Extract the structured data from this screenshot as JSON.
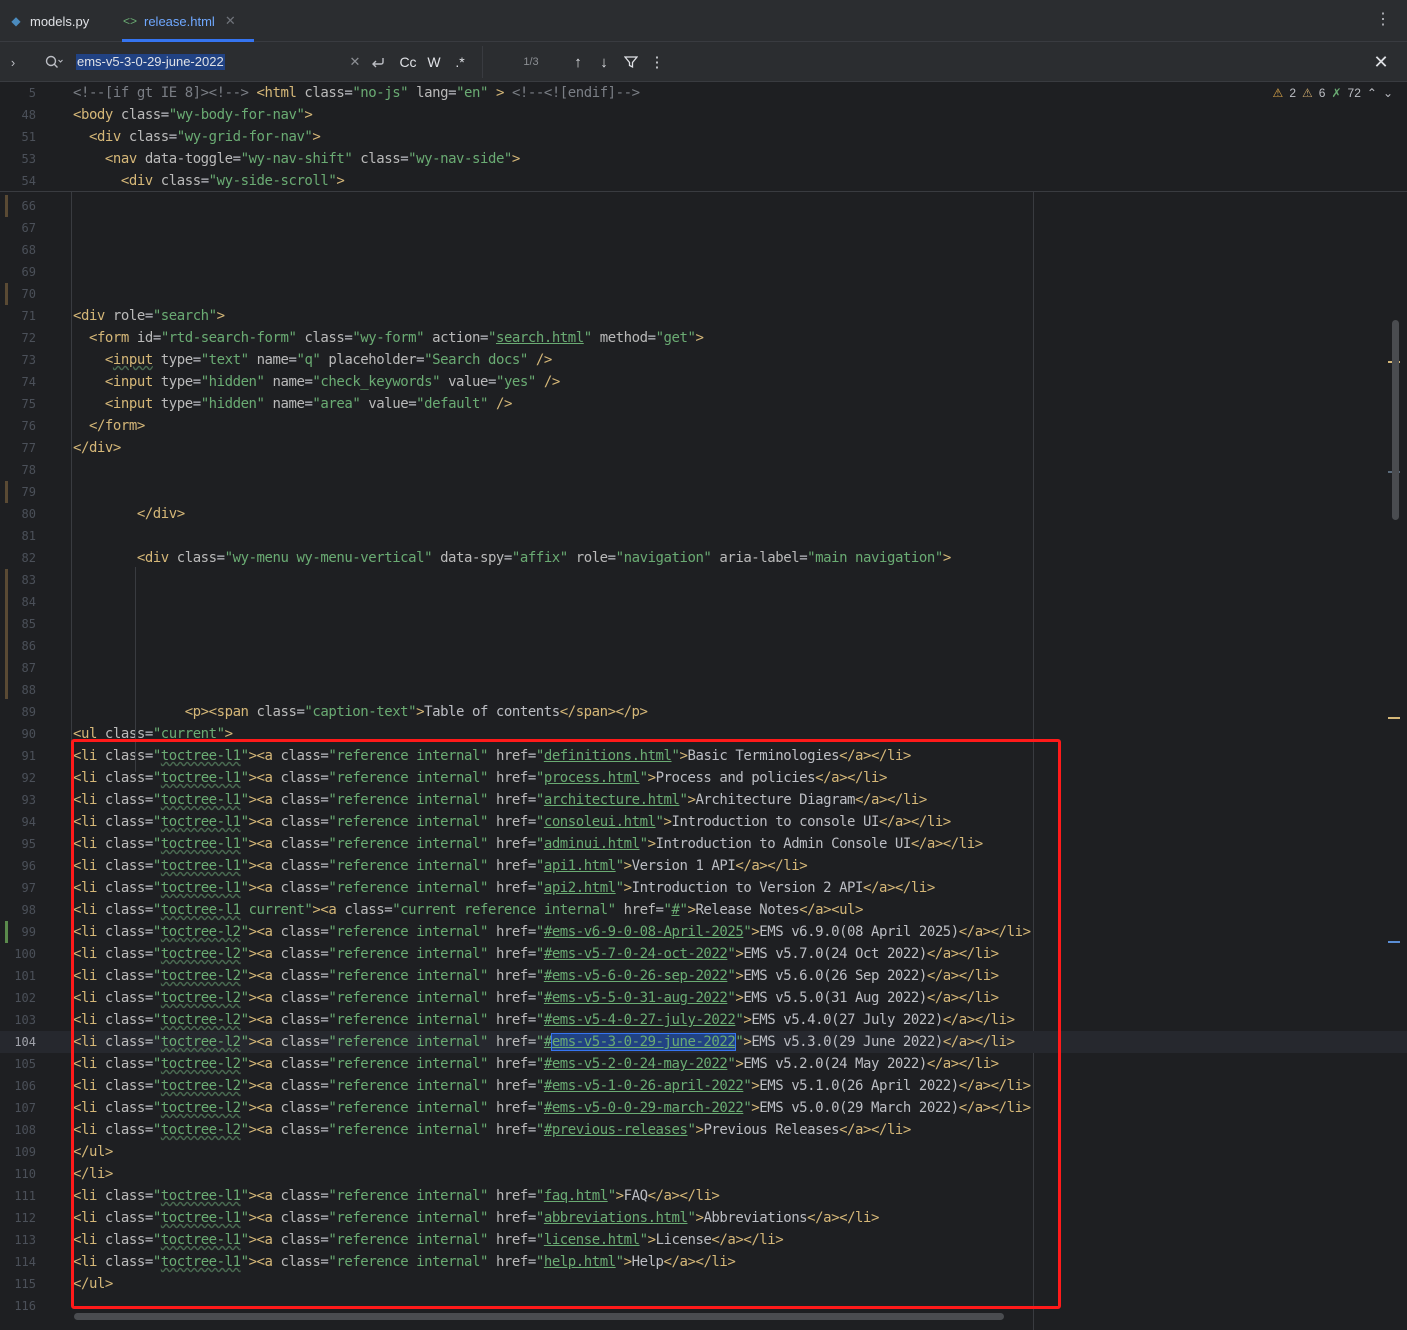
{
  "tabs": [
    {
      "label": "models.py",
      "icon": "python-icon"
    },
    {
      "label": "release.html",
      "icon": "html-icon",
      "active": true
    }
  ],
  "search": {
    "query": "ems-v5-3-0-29-june-2022",
    "count": "1/3",
    "case_label": "Cc",
    "word_label": "W",
    "regex_label": ".*"
  },
  "inspections": {
    "warnings_a": "2",
    "warnings_b": "6",
    "typos": "72"
  },
  "sticky_lines": [
    {
      "num": "5",
      "html": "<span class='c'>&lt;!--[if gt IE 8]&gt;&lt;!--&gt;</span> <span class='t'>&lt;html</span> <span class='a'>class</span>=<span class='v'>\"no-js\"</span> <span class='a'>lang</span>=<span class='v'>\"en\"</span> <span class='t'>&gt;</span> <span class='c'>&lt;!--&lt;![endif]--&gt;</span>"
    },
    {
      "num": "48",
      "html": "<span class='t'>&lt;body</span> <span class='a'>class</span>=<span class='v'>\"wy-body-for-nav\"</span><span class='t'>&gt;</span>"
    },
    {
      "num": "51",
      "html": "  <span class='t'>&lt;div</span> <span class='a'>class</span>=<span class='v'>\"wy-grid-for-nav\"</span><span class='t'>&gt;</span>"
    },
    {
      "num": "53",
      "html": "    <span class='t'>&lt;nav</span> <span class='a'>data-toggle</span>=<span class='v'>\"wy-nav-shift\"</span> <span class='a'>class</span>=<span class='v'>\"wy-nav-side\"</span><span class='t'>&gt;</span>"
    },
    {
      "num": "54",
      "html": "      <span class='t'>&lt;div</span> <span class='a'>class</span>=<span class='v'>\"wy-side-scroll\"</span><span class='t'>&gt;</span>"
    }
  ],
  "lines": [
    {
      "num": "66",
      "html": ""
    },
    {
      "num": "67",
      "html": ""
    },
    {
      "num": "68",
      "html": ""
    },
    {
      "num": "69",
      "html": ""
    },
    {
      "num": "70",
      "html": ""
    },
    {
      "num": "71",
      "html": "<span class='t'>&lt;div</span> <span class='a'>role</span>=<span class='v'>\"search\"</span><span class='t'>&gt;</span>"
    },
    {
      "num": "72",
      "html": "  <span class='t'>&lt;form</span> <span class='a'>id</span>=<span class='v'>\"rtd-search-form\"</span> <span class='a'>class</span>=<span class='v'>\"wy-form\"</span> <span class='a'>action</span>=<span class='v'>\"</span><span class='u'>search.html</span><span class='v'>\"</span> <span class='a'>method</span>=<span class='v'>\"get\"</span><span class='t'>&gt;</span>"
    },
    {
      "num": "73",
      "html": "    <span class='t'>&lt;<span class='sq'>input</span></span> <span class='a'>type</span>=<span class='v'>\"text\"</span> <span class='a'>name</span>=<span class='v'>\"q\"</span> <span class='a'>placeholder</span>=<span class='v'>\"Search docs\"</span> <span class='t'>/&gt;</span>"
    },
    {
      "num": "74",
      "html": "    <span class='t'>&lt;input</span> <span class='a'>type</span>=<span class='v'>\"hidden\"</span> <span class='a'>name</span>=<span class='v'>\"check_keywords\"</span> <span class='a'>value</span>=<span class='v'>\"yes\"</span> <span class='t'>/&gt;</span>"
    },
    {
      "num": "75",
      "html": "    <span class='t'>&lt;input</span> <span class='a'>type</span>=<span class='v'>\"hidden\"</span> <span class='a'>name</span>=<span class='v'>\"area\"</span> <span class='a'>value</span>=<span class='v'>\"default\"</span> <span class='t'>/&gt;</span>"
    },
    {
      "num": "76",
      "html": "  <span class='t'>&lt;/form&gt;</span>"
    },
    {
      "num": "77",
      "html": "<span class='t'>&lt;/div&gt;</span>"
    },
    {
      "num": "78",
      "html": ""
    },
    {
      "num": "79",
      "html": ""
    },
    {
      "num": "80",
      "html": "        <span class='t'>&lt;/div&gt;</span>"
    },
    {
      "num": "81",
      "html": ""
    },
    {
      "num": "82",
      "html": "        <span class='t'>&lt;div</span> <span class='a'>class</span>=<span class='v'>\"wy-menu wy-menu-vertical\"</span> <span class='a'>data-spy</span>=<span class='v'>\"affix\"</span> <span class='a'>role</span>=<span class='v'>\"navigation\"</span> <span class='a'>aria-label</span>=<span class='v'>\"main navigation\"</span><span class='t'>&gt;</span>"
    },
    {
      "num": "83",
      "html": ""
    },
    {
      "num": "84",
      "html": ""
    },
    {
      "num": "85",
      "html": ""
    },
    {
      "num": "86",
      "html": ""
    },
    {
      "num": "87",
      "html": ""
    },
    {
      "num": "88",
      "html": ""
    },
    {
      "num": "89",
      "html": "              <span class='t'>&lt;p&gt;&lt;span</span> <span class='a'>class</span>=<span class='v'>\"caption-text\"</span><span class='t'>&gt;</span>Table of contents<span class='t'>&lt;/span&gt;&lt;/p&gt;</span>"
    },
    {
      "num": "90",
      "html": "<span class='t'>&lt;ul</span> <span class='a'>class</span>=<span class='v'>\"current\"</span><span class='t'>&gt;</span>"
    },
    {
      "num": "91",
      "html": "<span class='t'>&lt;li</span> <span class='a'>class</span>=<span class='v'>\"<span class='sq'>toctree-l1</span>\"</span><span class='t'>&gt;&lt;a</span> <span class='a'>class</span>=<span class='v'>\"reference internal\"</span> <span class='a'>href</span>=<span class='v'>\"</span><span class='u'>definitions.html</span><span class='v'>\"</span><span class='t'>&gt;</span>Basic Terminologies<span class='t'>&lt;/a&gt;&lt;/li&gt;</span>"
    },
    {
      "num": "92",
      "html": "<span class='t'>&lt;li</span> <span class='a'>class</span>=<span class='v'>\"<span class='sq'>toctree-l1</span>\"</span><span class='t'>&gt;&lt;a</span> <span class='a'>class</span>=<span class='v'>\"reference internal\"</span> <span class='a'>href</span>=<span class='v'>\"</span><span class='u'>process.html</span><span class='v'>\"</span><span class='t'>&gt;</span>Process and policies<span class='t'>&lt;/a&gt;&lt;/li&gt;</span>"
    },
    {
      "num": "93",
      "html": "<span class='t'>&lt;li</span> <span class='a'>class</span>=<span class='v'>\"<span class='sq'>toctree-l1</span>\"</span><span class='t'>&gt;&lt;a</span> <span class='a'>class</span>=<span class='v'>\"reference internal\"</span> <span class='a'>href</span>=<span class='v'>\"</span><span class='u'>architecture.html</span><span class='v'>\"</span><span class='t'>&gt;</span>Architecture Diagram<span class='t'>&lt;/a&gt;&lt;/li&gt;</span>"
    },
    {
      "num": "94",
      "html": "<span class='t'>&lt;li</span> <span class='a'>class</span>=<span class='v'>\"<span class='sq'>toctree-l1</span>\"</span><span class='t'>&gt;&lt;a</span> <span class='a'>class</span>=<span class='v'>\"reference internal\"</span> <span class='a'>href</span>=<span class='v'>\"</span><span class='u'>consoleui.html</span><span class='v'>\"</span><span class='t'>&gt;</span>Introduction to console UI<span class='t'>&lt;/a&gt;&lt;/li&gt;</span>"
    },
    {
      "num": "95",
      "html": "<span class='t'>&lt;li</span> <span class='a'>class</span>=<span class='v'>\"<span class='sq'>toctree-l1</span>\"</span><span class='t'>&gt;&lt;a</span> <span class='a'>class</span>=<span class='v'>\"reference internal\"</span> <span class='a'>href</span>=<span class='v'>\"</span><span class='u'>adminui.html</span><span class='v'>\"</span><span class='t'>&gt;</span>Introduction to Admin Console UI<span class='t'>&lt;/a&gt;&lt;/li&gt;</span>"
    },
    {
      "num": "96",
      "html": "<span class='t'>&lt;li</span> <span class='a'>class</span>=<span class='v'>\"<span class='sq'>toctree-l1</span>\"</span><span class='t'>&gt;&lt;a</span> <span class='a'>class</span>=<span class='v'>\"reference internal\"</span> <span class='a'>href</span>=<span class='v'>\"</span><span class='u'>api1.html</span><span class='v'>\"</span><span class='t'>&gt;</span>Version 1 API<span class='t'>&lt;/a&gt;&lt;/li&gt;</span>"
    },
    {
      "num": "97",
      "html": "<span class='t'>&lt;li</span> <span class='a'>class</span>=<span class='v'>\"<span class='sq'>toctree-l1</span>\"</span><span class='t'>&gt;&lt;a</span> <span class='a'>class</span>=<span class='v'>\"reference internal\"</span> <span class='a'>href</span>=<span class='v'>\"</span><span class='u'>api2.html</span><span class='v'>\"</span><span class='t'>&gt;</span>Introduction to Version 2 API<span class='t'>&lt;/a&gt;&lt;/li&gt;</span>"
    },
    {
      "num": "98",
      "html": "<span class='t'>&lt;li</span> <span class='a'>class</span>=<span class='v'>\"<span class='sq'>toctree-l1</span> current\"</span><span class='t'>&gt;&lt;a</span> <span class='a'>class</span>=<span class='v'>\"current reference internal\"</span> <span class='a'>href</span>=<span class='v'>\"</span><span class='u'>#</span><span class='v'>\"</span><span class='t'>&gt;</span>Release Notes<span class='t'>&lt;/a&gt;&lt;ul&gt;</span>"
    },
    {
      "num": "99",
      "html": "<span class='t'>&lt;li</span> <span class='a'>class</span>=<span class='v'>\"<span class='sq'>toctree-l2</span>\"</span><span class='t'>&gt;&lt;a</span> <span class='a'>class</span>=<span class='v'>\"reference internal\"</span> <span class='a'>href</span>=<span class='v'>\"</span><span class='u'>#ems-v6-9-0-08-April-2025</span><span class='v'>\"</span><span class='t'>&gt;</span>EMS v6.9.0(08 April 2025)<span class='t'>&lt;/a&gt;&lt;/li&gt;</span>"
    },
    {
      "num": "100",
      "html": "<span class='t'>&lt;li</span> <span class='a'>class</span>=<span class='v'>\"<span class='sq'>toctree-l2</span>\"</span><span class='t'>&gt;&lt;a</span> <span class='a'>class</span>=<span class='v'>\"reference internal\"</span> <span class='a'>href</span>=<span class='v'>\"</span><span class='u'>#ems-v5-7-0-24-oct-2022</span><span class='v'>\"</span><span class='t'>&gt;</span>EMS v5.7.0(24 Oct 2022)<span class='t'>&lt;/a&gt;&lt;/li&gt;</span>"
    },
    {
      "num": "101",
      "html": "<span class='t'>&lt;li</span> <span class='a'>class</span>=<span class='v'>\"<span class='sq'>toctree-l2</span>\"</span><span class='t'>&gt;&lt;a</span> <span class='a'>class</span>=<span class='v'>\"reference internal\"</span> <span class='a'>href</span>=<span class='v'>\"</span><span class='u'>#ems-v5-6-0-26-sep-2022</span><span class='v'>\"</span><span class='t'>&gt;</span>EMS v5.6.0(26 Sep 2022)<span class='t'>&lt;/a&gt;&lt;/li&gt;</span>"
    },
    {
      "num": "102",
      "html": "<span class='t'>&lt;li</span> <span class='a'>class</span>=<span class='v'>\"<span class='sq'>toctree-l2</span>\"</span><span class='t'>&gt;&lt;a</span> <span class='a'>class</span>=<span class='v'>\"reference internal\"</span> <span class='a'>href</span>=<span class='v'>\"</span><span class='u'>#ems-v5-5-0-31-aug-2022</span><span class='v'>\"</span><span class='t'>&gt;</span>EMS v5.5.0(31 Aug 2022)<span class='t'>&lt;/a&gt;&lt;/li&gt;</span>"
    },
    {
      "num": "103",
      "html": "<span class='t'>&lt;li</span> <span class='a'>class</span>=<span class='v'>\"<span class='sq'>toctree-l2</span>\"</span><span class='t'>&gt;&lt;a</span> <span class='a'>class</span>=<span class='v'>\"reference internal\"</span> <span class='a'>href</span>=<span class='v'>\"</span><span class='u'>#ems-v5-4-0-27-july-2022</span><span class='v'>\"</span><span class='t'>&gt;</span>EMS v5.4.0(27 July 2022)<span class='t'>&lt;/a&gt;&lt;/li&gt;</span>"
    },
    {
      "num": "104",
      "current": true,
      "html": "<span class='t'>&lt;li</span> <span class='a'>class</span>=<span class='v'>\"<span class='sq'>toctree-l2</span>\"</span><span class='t'>&gt;&lt;a</span> <span class='a'>class</span>=<span class='v'>\"reference internal\"</span> <span class='a'>href</span>=<span class='v'>\"</span><span class='u'>#</span><span class='hl'>ems-v5-3-0-29-june-2022</span><span class='v'>\"</span><span class='t'>&gt;</span>EMS v5.3.0(29 June 2022)<span class='t'>&lt;/a&gt;&lt;/li&gt;</span>"
    },
    {
      "num": "105",
      "html": "<span class='t'>&lt;li</span> <span class='a'>class</span>=<span class='v'>\"<span class='sq'>toctree-l2</span>\"</span><span class='t'>&gt;&lt;a</span> <span class='a'>class</span>=<span class='v'>\"reference internal\"</span> <span class='a'>href</span>=<span class='v'>\"</span><span class='u'>#ems-v5-2-0-24-may-2022</span><span class='v'>\"</span><span class='t'>&gt;</span>EMS v5.2.0(24 May 2022)<span class='t'>&lt;/a&gt;&lt;/li&gt;</span>"
    },
    {
      "num": "106",
      "html": "<span class='t'>&lt;li</span> <span class='a'>class</span>=<span class='v'>\"<span class='sq'>toctree-l2</span>\"</span><span class='t'>&gt;&lt;a</span> <span class='a'>class</span>=<span class='v'>\"reference internal\"</span> <span class='a'>href</span>=<span class='v'>\"</span><span class='u'>#ems-v5-1-0-26-april-2022</span><span class='v'>\"</span><span class='t'>&gt;</span>EMS v5.1.0(26 April 2022)<span class='t'>&lt;/a&gt;&lt;/li&gt;</span>"
    },
    {
      "num": "107",
      "html": "<span class='t'>&lt;li</span> <span class='a'>class</span>=<span class='v'>\"<span class='sq'>toctree-l2</span>\"</span><span class='t'>&gt;&lt;a</span> <span class='a'>class</span>=<span class='v'>\"reference internal\"</span> <span class='a'>href</span>=<span class='v'>\"</span><span class='u'>#ems-v5-0-0-29-march-2022</span><span class='v'>\"</span><span class='t'>&gt;</span>EMS v5.0.0(29 March 2022)<span class='t'>&lt;/a&gt;&lt;/li&gt;</span>"
    },
    {
      "num": "108",
      "html": "<span class='t'>&lt;li</span> <span class='a'>class</span>=<span class='v'>\"<span class='sq'>toctree-l2</span>\"</span><span class='t'>&gt;&lt;a</span> <span class='a'>class</span>=<span class='v'>\"reference internal\"</span> <span class='a'>href</span>=<span class='v'>\"</span><span class='u'>#previous-releases</span><span class='v'>\"</span><span class='t'>&gt;</span>Previous Releases<span class='t'>&lt;/a&gt;&lt;/li&gt;</span>"
    },
    {
      "num": "109",
      "html": "<span class='t'>&lt;/ul&gt;</span>"
    },
    {
      "num": "110",
      "html": "<span class='t'>&lt;/li&gt;</span>"
    },
    {
      "num": "111",
      "html": "<span class='t'>&lt;li</span> <span class='a'>class</span>=<span class='v'>\"<span class='sq'>toctree-l1</span>\"</span><span class='t'>&gt;&lt;a</span> <span class='a'>class</span>=<span class='v'>\"reference internal\"</span> <span class='a'>href</span>=<span class='v'>\"</span><span class='u'>faq.html</span><span class='v'>\"</span><span class='t'>&gt;</span>FAQ<span class='t'>&lt;/a&gt;&lt;/li&gt;</span>"
    },
    {
      "num": "112",
      "html": "<span class='t'>&lt;li</span> <span class='a'>class</span>=<span class='v'>\"<span class='sq'>toctree-l1</span>\"</span><span class='t'>&gt;&lt;a</span> <span class='a'>class</span>=<span class='v'>\"reference internal\"</span> <span class='a'>href</span>=<span class='v'>\"</span><span class='u'>abbreviations.html</span><span class='v'>\"</span><span class='t'>&gt;</span>Abbreviations<span class='t'>&lt;/a&gt;&lt;/li&gt;</span>"
    },
    {
      "num": "113",
      "html": "<span class='t'>&lt;li</span> <span class='a'>class</span>=<span class='v'>\"<span class='sq'>toctree-l1</span>\"</span><span class='t'>&gt;&lt;a</span> <span class='a'>class</span>=<span class='v'>\"reference internal\"</span> <span class='a'>href</span>=<span class='v'>\"</span><span class='u'>license.html</span><span class='v'>\"</span><span class='t'>&gt;</span>License<span class='t'>&lt;/a&gt;&lt;/li&gt;</span>"
    },
    {
      "num": "114",
      "html": "<span class='t'>&lt;li</span> <span class='a'>class</span>=<span class='v'>\"<span class='sq'>toctree-l1</span>\"</span><span class='t'>&gt;&lt;a</span> <span class='a'>class</span>=<span class='v'>\"reference internal\"</span> <span class='a'>href</span>=<span class='v'>\"</span><span class='u'>help.html</span><span class='v'>\"</span><span class='t'>&gt;</span>Help<span class='t'>&lt;/a&gt;&lt;/li&gt;</span>"
    },
    {
      "num": "115",
      "html": "<span class='t'>&lt;/ul&gt;</span>"
    },
    {
      "num": "116",
      "html": ""
    }
  ],
  "colors": {
    "accent": "#3574f0",
    "highlight_box": "#ff1a1a",
    "tag": "#d5b778",
    "string": "#6aab73"
  }
}
